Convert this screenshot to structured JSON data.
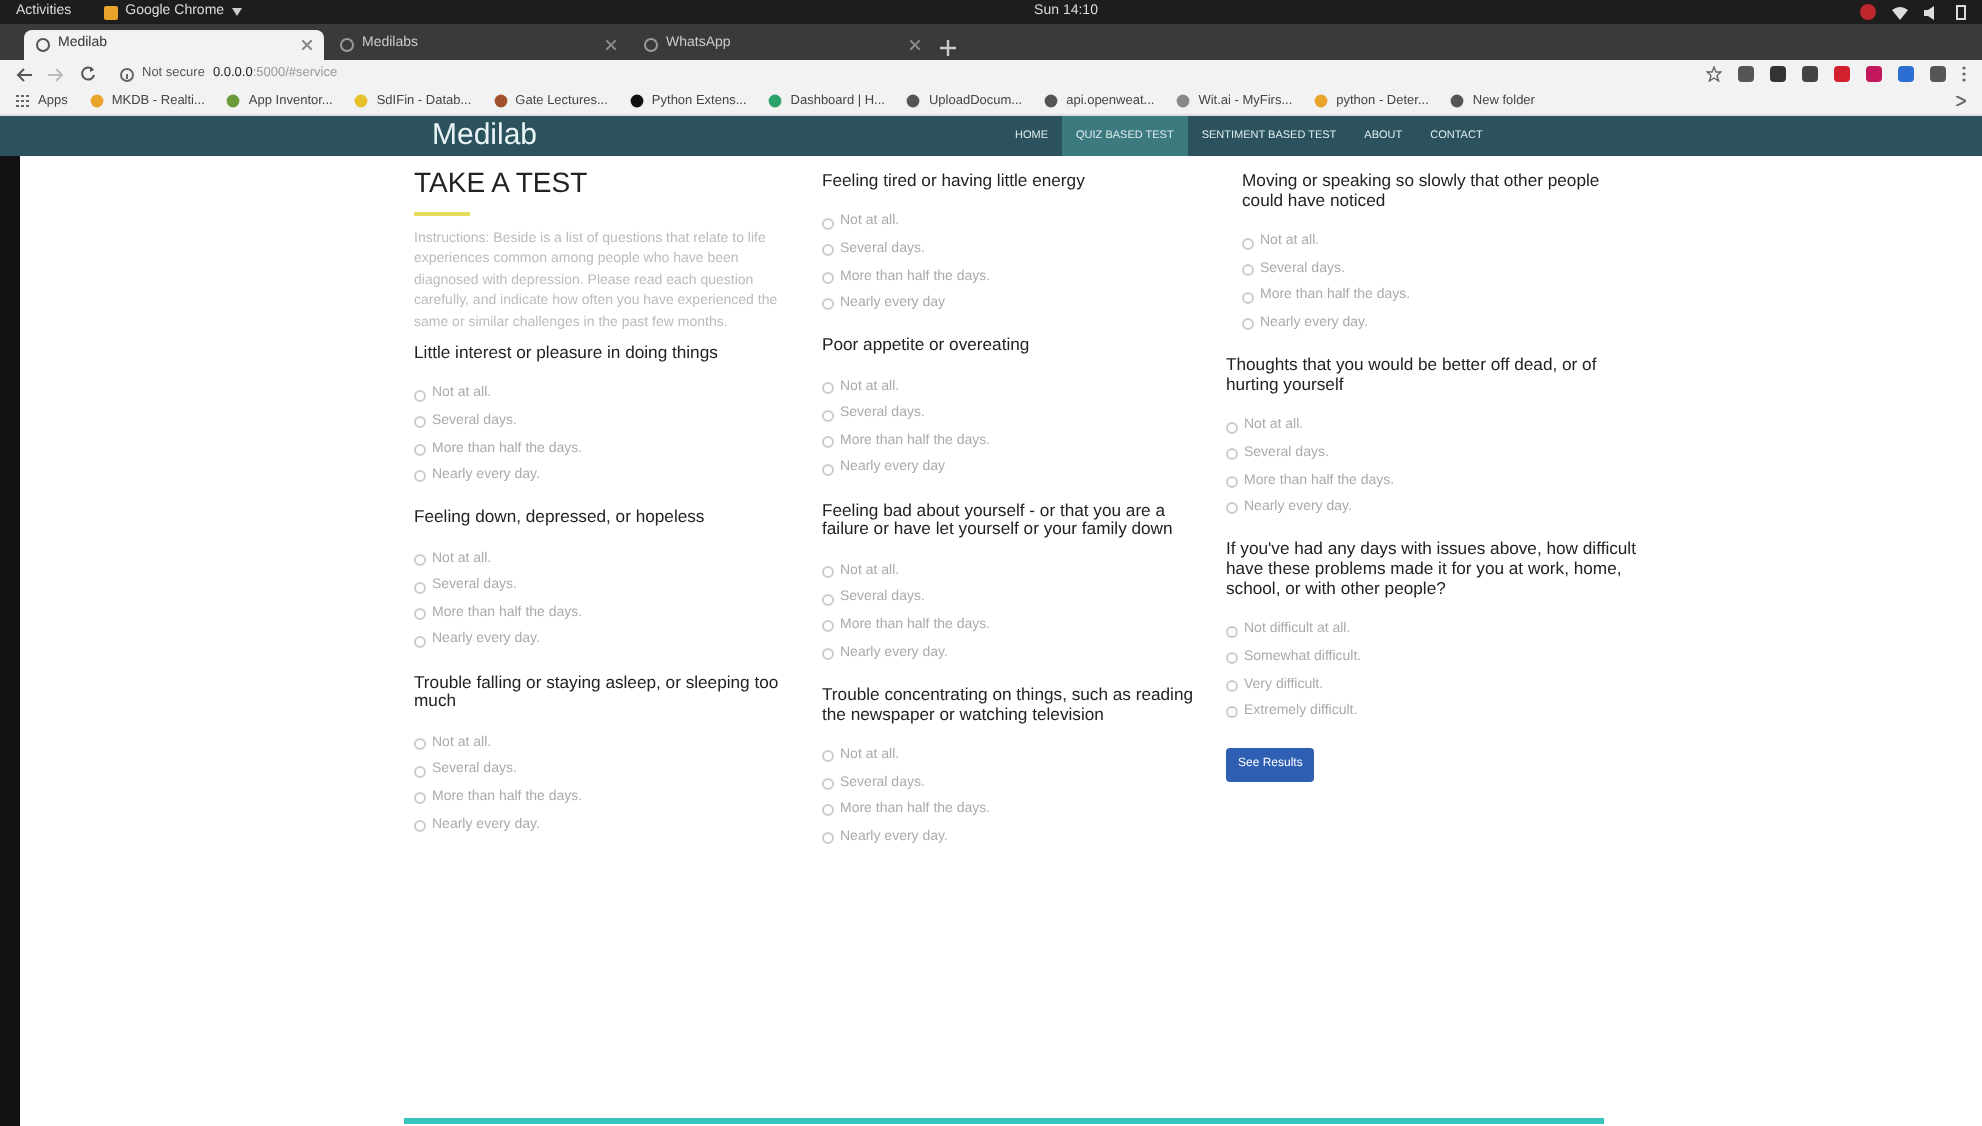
{
  "system_bar": {
    "activities": "Activities",
    "app_menu": "Google Chrome",
    "clock": "Sun 14:10"
  },
  "browser": {
    "tabs": [
      {
        "title": "Medilab",
        "selected": true
      },
      {
        "title": "Medilabs",
        "selected": false
      },
      {
        "title": "WhatsApp",
        "selected": false
      }
    ],
    "security": "Not secure",
    "url_host": "0.0.0.0",
    "url_path": ":5000/#service",
    "bookmarks": [
      "Apps",
      "MKDB - Realti...",
      "App Inventor...",
      "SdIFin - Datab...",
      "Gate Lectures...",
      "Python Extens...",
      "Dashboard | H...",
      "UploadDocum...",
      "api.openweat...",
      "Wit.ai - MyFirs...",
      "python - Deter...",
      "New folder"
    ]
  },
  "site": {
    "logo": "Medilab",
    "nav": [
      {
        "label": "HOME",
        "selected": false
      },
      {
        "label": "QUIZ BASED TEST",
        "selected": true
      },
      {
        "label": "SENTIMENT BASED TEST",
        "selected": false
      },
      {
        "label": "ABOUT",
        "selected": false
      },
      {
        "label": "CONTACT",
        "selected": false
      }
    ]
  },
  "page": {
    "heading": "TAKE A TEST",
    "instructions": "Instructions: Beside is a list of questions that relate to life experiences common among people who have been diagnosed with depression. Please read each question carefully, and indicate how often you have experienced the same or similar challenges in the past few months.",
    "columns": [
      {
        "questions": [
          {
            "text": "Little interest or pleasure in doing things",
            "options": [
              {
                "label": "Not at all.",
                "selected": false
              },
              {
                "label": "Several days.",
                "selected": false
              },
              {
                "label": "More than half the days.",
                "selected": false
              },
              {
                "label": "Nearly every day.",
                "selected": false
              }
            ]
          },
          {
            "text": "Feeling down, depressed, or hopeless",
            "options": [
              {
                "label": "Not at all.",
                "selected": false
              },
              {
                "label": "Several days.",
                "selected": false
              },
              {
                "label": "More than half the days.",
                "selected": false
              },
              {
                "label": "Nearly every day.",
                "selected": false
              }
            ]
          },
          {
            "text": "Trouble falling or staying asleep, or sleeping too much",
            "options": [
              {
                "label": "Not at all.",
                "selected": false
              },
              {
                "label": "Several days.",
                "selected": false
              },
              {
                "label": "More than half the days.",
                "selected": false
              },
              {
                "label": "Nearly every day.",
                "selected": false
              }
            ]
          }
        ]
      },
      {
        "questions": [
          {
            "text": "Feeling tired or having little energy",
            "options": [
              {
                "label": "Not at all.",
                "selected": false
              },
              {
                "label": "Several days.",
                "selected": false
              },
              {
                "label": "More than half the days.",
                "selected": false
              },
              {
                "label": "Nearly every day",
                "selected": false
              }
            ]
          },
          {
            "text": "Poor appetite or overeating",
            "options": [
              {
                "label": "Not at all.",
                "selected": false
              },
              {
                "label": "Several days.",
                "selected": false
              },
              {
                "label": "More than half the days.",
                "selected": false
              },
              {
                "label": "Nearly every day",
                "selected": false
              }
            ]
          },
          {
            "text": "Feeling bad about yourself - or that you are a failure or have let yourself or your family down",
            "options": [
              {
                "label": "Not at all.",
                "selected": false
              },
              {
                "label": "Several days.",
                "selected": false
              },
              {
                "label": "More than half the days.",
                "selected": false
              },
              {
                "label": "Nearly every day.",
                "selected": false
              }
            ]
          },
          {
            "text": "Trouble concentrating on things, such as reading the newspaper or watching television",
            "options": [
              {
                "label": "Not at all.",
                "selected": false
              },
              {
                "label": "Several days.",
                "selected": false
              },
              {
                "label": "More than half the days.",
                "selected": false
              },
              {
                "label": "Nearly every day.",
                "selected": false
              }
            ]
          }
        ]
      },
      {
        "questions": [
          {
            "text": "Moving or speaking so slowly that other people could have noticed",
            "options": [
              {
                "label": "Not at all.",
                "selected": false
              },
              {
                "label": "Several days.",
                "selected": false
              },
              {
                "label": "More than half the days.",
                "selected": false
              },
              {
                "label": "Nearly every day.",
                "selected": false
              }
            ]
          },
          {
            "text": "Thoughts that you would be better off dead, or of hurting yourself",
            "options": [
              {
                "label": "Not at all.",
                "selected": false
              },
              {
                "label": "Several days.",
                "selected": false
              },
              {
                "label": "More than half the days.",
                "selected": false
              },
              {
                "label": "Nearly every day.",
                "selected": false
              }
            ]
          },
          {
            "text": "If you've had any days with issues above, how difficult have these problems made it for you at work, home, school, or with other people?",
            "options": [
              {
                "label": "Not difficult at all.",
                "selected": false
              },
              {
                "label": "Somewhat difficult.",
                "selected": false
              },
              {
                "label": "Very difficult.",
                "selected": false
              },
              {
                "label": "Extremely difficult.",
                "selected": false
              }
            ]
          }
        ]
      }
    ],
    "submit": "See Results"
  }
}
